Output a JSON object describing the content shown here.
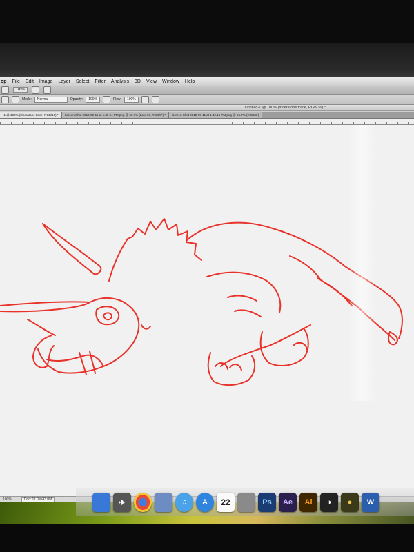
{
  "menubar": {
    "app_fragment": "op",
    "items": [
      "File",
      "Edit",
      "Image",
      "Layer",
      "Select",
      "Filter",
      "Analysis",
      "3D",
      "View",
      "Window",
      "Help"
    ]
  },
  "appbar": {
    "zoom": "100%"
  },
  "optionsbar": {
    "mode_label": "Mode:",
    "mode_value": "Normal",
    "opacity_label": "Opacity:",
    "opacity_value": "100%",
    "flow_label": "Flow:",
    "flow_value": "100%"
  },
  "document": {
    "window_title": "Untitled-1 @ 100% (triceratops trace, RGB/16) *",
    "tabs": [
      "-1 @ 100% (triceratops trace, RGB/16) *",
      "Screen Shot 2012-09-11 at 1.39.24 PM.png @ 66.7% (Layer 0, RGB/8*) *",
      "Screen Shot 2012-09-11 at 1.42.16 PM.png @ 66.7% (RGB/8*)"
    ]
  },
  "status": {
    "doc": "Doc: 11.0M/43.0M"
  },
  "drawing": {
    "subject": "triceratops trace",
    "stroke_color": "#e8322a"
  },
  "dock": {
    "calendar_day": "22",
    "apps": [
      {
        "icon": "finder-icon",
        "label": ""
      },
      {
        "icon": "launchpad-icon",
        "label": ""
      },
      {
        "icon": "chrome-icon",
        "label": ""
      },
      {
        "icon": "preview-icon",
        "label": ""
      },
      {
        "icon": "itunes-icon",
        "label": ""
      },
      {
        "icon": "app-store-icon",
        "label": ""
      },
      {
        "icon": "calendar-icon",
        "label": "22"
      },
      {
        "icon": "photo-booth-icon",
        "label": ""
      },
      {
        "icon": "photoshop-icon",
        "label": "Ps"
      },
      {
        "icon": "after-effects-icon",
        "label": "Ae"
      },
      {
        "icon": "illustrator-icon",
        "label": "Ai"
      },
      {
        "icon": "final-cut-icon",
        "label": ""
      },
      {
        "icon": "dvd-player-icon",
        "label": ""
      },
      {
        "icon": "word-icon",
        "label": "W"
      }
    ]
  },
  "colors": {
    "stroke": "#e8322a",
    "canvas": "#f1f1f1"
  }
}
